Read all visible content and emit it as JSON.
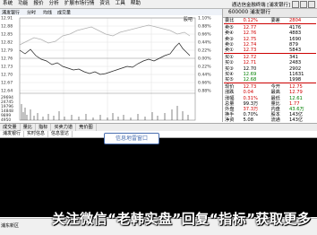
{
  "menubar": {
    "items": [
      "系统",
      "功能",
      "报价",
      "分析",
      "扩展市场行情",
      "资讯",
      "工具",
      "帮助"
    ],
    "title": "通达信金融终端 [浦发银行]"
  },
  "chart": {
    "header_stock": "浦发银行",
    "header_period": "分时",
    "header_mode": "均线",
    "header_volume_label": "成交量",
    "top_right_label": "股吧",
    "price_ticks": [
      "12.91",
      "12.88",
      "12.85",
      "12.82",
      "12.79",
      "12.76",
      "12.73",
      "12.70",
      "12.67",
      "12.64",
      "12.61"
    ],
    "pct_ticks": [
      "1.10%",
      "0.88%",
      "0.66%",
      "0.44%",
      "0.22%",
      "0.00%",
      "0.22%",
      "0.44%",
      "0.66%",
      "0.88%",
      "1.10%"
    ],
    "volume_ticks": [
      "29694",
      "24745",
      "19796",
      "14848",
      "9899",
      "4950"
    ]
  },
  "quote_panel": {
    "code": "600000",
    "name": "浦发银行",
    "rows": [
      {
        "label": "委比",
        "value": "0.12%",
        "extra_label": "委差",
        "extra": "2804"
      },
      {
        "label": "卖⑤",
        "value": "12.77",
        "extra": "4176"
      },
      {
        "label": "卖④",
        "value": "12.76",
        "extra": "4883"
      },
      {
        "label": "卖③",
        "value": "12.75",
        "extra": "1690"
      },
      {
        "label": "卖②",
        "value": "12.74",
        "extra": "879"
      },
      {
        "label": "卖①",
        "value": "12.73",
        "extra": "5843"
      },
      {
        "label": "买①",
        "value": "12.72",
        "extra": "341"
      },
      {
        "label": "买②",
        "value": "12.71",
        "extra": "2483"
      },
      {
        "label": "买③",
        "value": "12.70",
        "extra": "2902"
      },
      {
        "label": "买④",
        "value": "12.69",
        "extra": "11631"
      },
      {
        "label": "买⑤",
        "value": "12.68",
        "extra": "1998"
      },
      {
        "label": "现价",
        "value": "12.73",
        "extra_label": "今开",
        "extra": "12.75"
      },
      {
        "label": "涨跌",
        "value": "0.04",
        "extra_label": "最高",
        "extra": "12.79"
      },
      {
        "label": "涨幅",
        "value": "0.31%",
        "extra_label": "最低",
        "extra": "12.61"
      },
      {
        "label": "总量",
        "value": "99.3万",
        "extra_label": "量比",
        "extra": "1.77"
      },
      {
        "label": "外盘",
        "value": "37.3万",
        "extra_label": "内盘",
        "extra": "43.6万"
      },
      {
        "label": "换手",
        "value": "0.70%",
        "extra_label": "股本",
        "extra": "143亿"
      },
      {
        "label": "净资",
        "value": "5.08",
        "extra_label": "流通",
        "extra": "143亿"
      }
    ]
  },
  "tabs": [
    "成交量",
    "量比",
    "指标",
    "买卖力道",
    "竞价图"
  ],
  "info_window": {
    "tabs": [
      "浦发银行",
      "实时信息",
      "信息雷达"
    ],
    "callout": "信息地雷窗口"
  },
  "status": {
    "left": "浦东新区"
  },
  "watermark": "关注微信“老韩实盘”回复“指标”获取更多"
}
